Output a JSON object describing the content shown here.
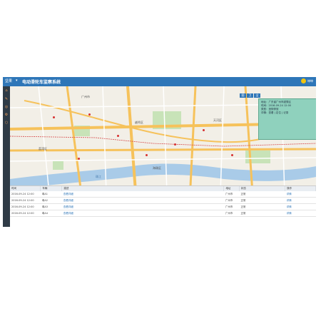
{
  "topbar": {
    "logo": "坚果",
    "caret": "▾",
    "title": "电动滑轮车监察系统",
    "user": "坤坤"
  },
  "sidebar": {
    "items": [
      {
        "icon": "home-icon"
      },
      {
        "icon": "edit-icon"
      },
      {
        "icon": "location-icon"
      },
      {
        "icon": "settings-icon"
      },
      {
        "icon": "info-icon"
      }
    ]
  },
  "map": {
    "controls": [
      "图",
      "卫",
      "全"
    ],
    "labels": [
      "广州市",
      "越秀区",
      "天河区",
      "荔湾区",
      "海珠区",
      "珠江"
    ],
    "popup": {
      "lines": [
        "地址：广东省广州市越秀区",
        "时间：2016-09-24 12:00",
        "类型：违规停放",
        "详情：查看 | 定位 | 记录"
      ]
    }
  },
  "table": {
    "headers": [
      "时间",
      "车辆",
      "描述",
      "地址",
      "状态",
      "操作"
    ],
    "rows": [
      {
        "time": "2016-09-24 12:00",
        "vehicle": "粤A1",
        "desc": "查看详细",
        "addr": "广州市",
        "status": "正常",
        "action": "详情"
      },
      {
        "time": "2016-09-24 12:00",
        "vehicle": "粤A2",
        "desc": "查看详细",
        "addr": "广州市",
        "status": "正常",
        "action": "详情"
      },
      {
        "time": "2016-09-24 12:00",
        "vehicle": "粤A3",
        "desc": "查看详细",
        "addr": "广州市",
        "status": "正常",
        "action": "详情"
      },
      {
        "time": "2016-09-24 12:00",
        "vehicle": "粤A4",
        "desc": "查看详细",
        "addr": "广州市",
        "status": "正常",
        "action": "详情"
      }
    ]
  },
  "colors": {
    "topbar": "#2e76b8",
    "sidebar": "#2f3b46",
    "popup": "#8fd1bd",
    "road_major": "#f6c25b",
    "river": "#a9cbe8",
    "park": "#c8e3b8"
  }
}
